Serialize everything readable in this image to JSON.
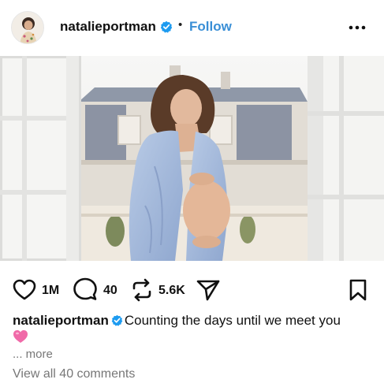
{
  "post": {
    "username": "natalieportman",
    "separator": "•",
    "follow_label": "Follow",
    "image_alt": "Pregnant woman in light blue shirt standing by open windows",
    "likes": "1M",
    "comments": "40",
    "reposts": "5.6K",
    "caption_text": "Counting the days until we meet you",
    "caption_emoji": "pink-heart",
    "more_label": "... more",
    "view_comments_label": "View all 40 comments"
  },
  "colors": {
    "accent": "#3a8fd6",
    "verified": "#1d9bf0",
    "muted": "#777777",
    "heart": "#e64a8c"
  },
  "icons": [
    "verified-icon",
    "more-options-icon",
    "heart-icon",
    "comment-icon",
    "repost-icon",
    "share-icon",
    "bookmark-icon"
  ]
}
